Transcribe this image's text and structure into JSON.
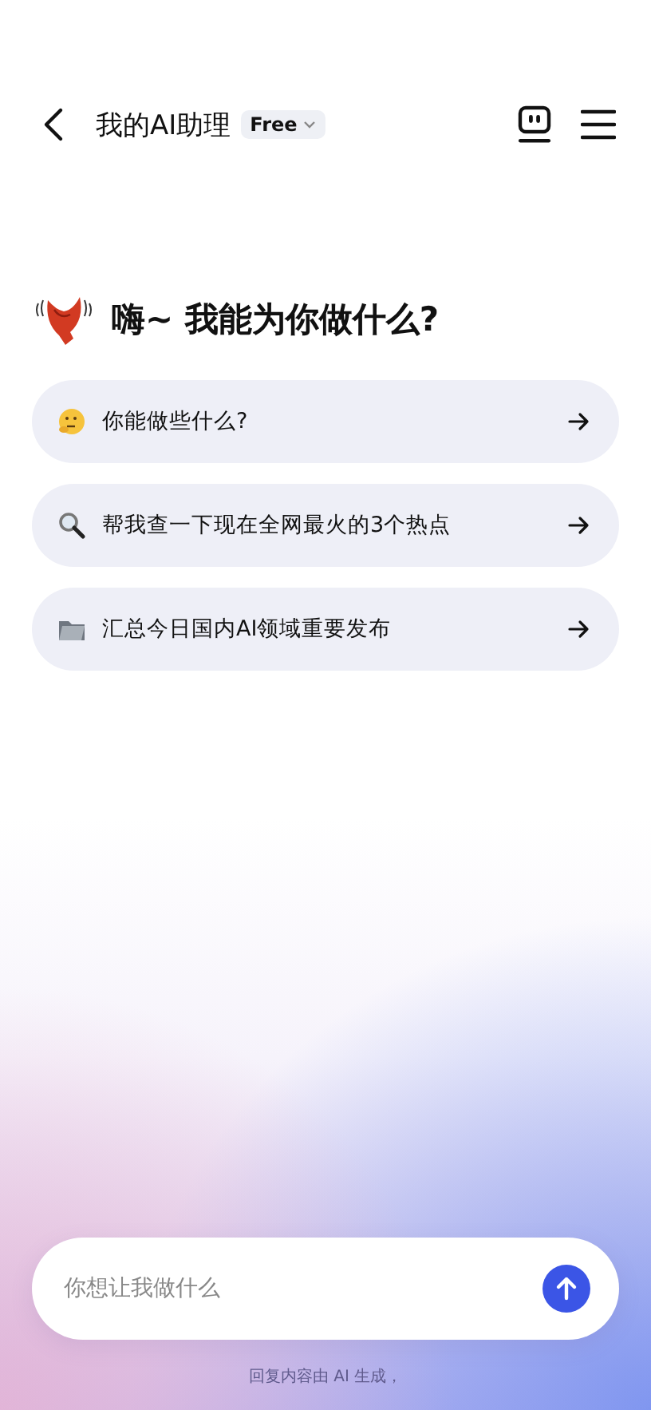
{
  "header": {
    "title": "我的AI助理",
    "plan_badge": "Free"
  },
  "greeting": "嗨~ 我能为你做什么?",
  "suggestions": [
    {
      "kind": "thinking",
      "text": "你能做些什么?"
    },
    {
      "kind": "search",
      "text": "帮我查一下现在全网最火的3个热点"
    },
    {
      "kind": "folder",
      "text": "汇总今日国内AI领域重要发布"
    }
  ],
  "input": {
    "placeholder": "你想让我做什么"
  },
  "footer_note": "回复内容由 AI 生成，"
}
